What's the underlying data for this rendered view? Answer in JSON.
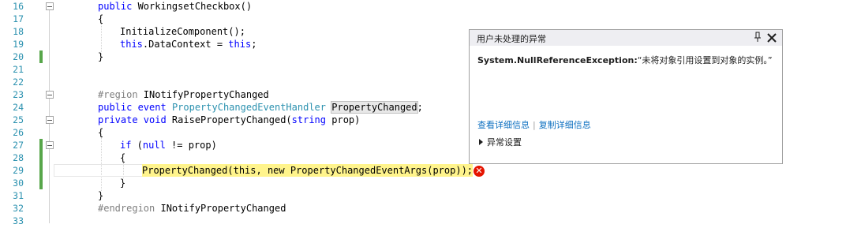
{
  "editor": {
    "line_numbers": [
      "16",
      "17",
      "18",
      "19",
      "20",
      "21",
      "22",
      "23",
      "24",
      "25",
      "26",
      "27",
      "28",
      "29",
      "30",
      "31",
      "32",
      "33"
    ],
    "lines": {
      "l16": {
        "kw": "public",
        "rest": " WorkingsetCheckbox()"
      },
      "l17": {
        "text": "{"
      },
      "l18": {
        "text": "InitializeComponent();"
      },
      "l19": {
        "kw": "this",
        "mid": ".DataContext = ",
        "kw2": "this",
        "end": ";"
      },
      "l20": {
        "text": "}"
      },
      "l23": {
        "cm": "#region",
        "rest": " INotifyPropertyChanged"
      },
      "l24": {
        "kw": "public event",
        "ty": "PropertyChangedEventHandler",
        "hl": "PropertyChanged",
        "end": ";"
      },
      "l25": {
        "kw": "private void",
        "rest": " RaisePropertyChanged(",
        "kw2": "string",
        "end": " prop)"
      },
      "l26": {
        "text": "{"
      },
      "l27": {
        "kw": "if",
        "rest": " (",
        "kw2": "null",
        "end": " != prop)"
      },
      "l28": {
        "text": "{"
      },
      "l29": {
        "text": "PropertyChanged(this, new PropertyChangedEventArgs(prop));"
      },
      "l30": {
        "text": "}"
      },
      "l31": {
        "text": "}"
      },
      "l32": {
        "cm": "#endregion",
        "rest": " INotifyPropertyChanged"
      }
    }
  },
  "popup": {
    "title": "用户未处理的异常",
    "pin_icon": "pin-icon",
    "close_icon": "close-icon",
    "exception_type": "System.NullReferenceException:",
    "exception_message": "“未将对象引用设置到对象的实例。”",
    "view_details": "查看详细信息",
    "separator": "|",
    "copy_details": "复制详细信息",
    "settings": "异常设置"
  },
  "error_icon": {
    "glyph": "✕",
    "color": "#e51400"
  },
  "colors": {
    "keyword": "#0000ff",
    "type": "#2b91af",
    "region": "#808080",
    "current_statement": "#fff48c",
    "change_bar": "#57a64a"
  }
}
